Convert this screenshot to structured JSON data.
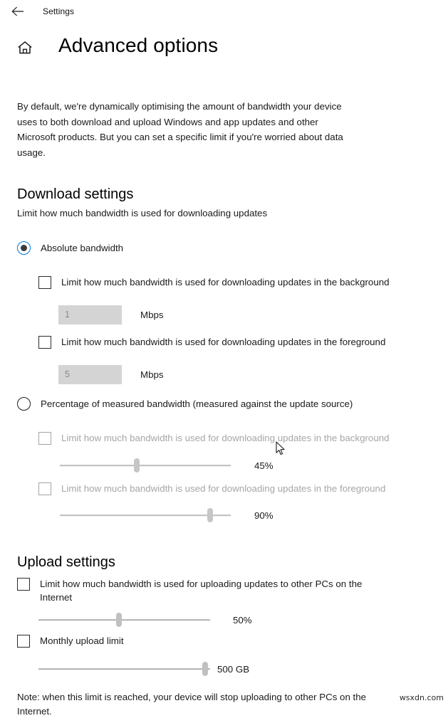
{
  "titlebar": {
    "back_icon": "back-arrow-icon",
    "label": "Settings"
  },
  "header": {
    "home_icon": "home-icon",
    "title": "Advanced options"
  },
  "intro": "By default, we're dynamically optimising the amount of bandwidth your device uses to both download and upload Windows and app updates and other Microsoft products. But you can set a specific limit if you're worried about data usage.",
  "download": {
    "heading": "Download settings",
    "subtitle": "Limit how much bandwidth is used for downloading updates",
    "absolute": {
      "radio_label": "Absolute bandwidth",
      "selected": true,
      "background": {
        "checkbox_label": "Limit how much bandwidth is used for downloading updates in the background",
        "checked": false,
        "value": "1",
        "unit": "Mbps"
      },
      "foreground": {
        "checkbox_label": "Limit how much bandwidth is used for downloading updates in the foreground",
        "checked": false,
        "value": "5",
        "unit": "Mbps"
      }
    },
    "percentage": {
      "radio_label": "Percentage of measured bandwidth (measured against the update source)",
      "selected": false,
      "background": {
        "checkbox_label": "Limit how much bandwidth is used for downloading updates in the background",
        "checked": false,
        "disabled": true,
        "slider_value": "45%",
        "slider_percent": 45
      },
      "foreground": {
        "checkbox_label": "Limit how much bandwidth is used for downloading updates in the foreground",
        "checked": false,
        "disabled": true,
        "slider_value": "90%",
        "slider_percent": 90
      }
    }
  },
  "upload": {
    "heading": "Upload settings",
    "bandwidth": {
      "checkbox_label": "Limit how much bandwidth is used for uploading updates to other PCs on the Internet",
      "checked": false,
      "slider_value": "50%",
      "slider_percent": 50
    },
    "monthly": {
      "checkbox_label": "Monthly upload limit",
      "checked": false,
      "slider_value": "500 GB",
      "slider_percent": 95
    },
    "note": "Note: when this limit is reached, your device will stop uploading to other PCs on the Internet."
  },
  "watermark": "wsxdn.com",
  "colors": {
    "accent": "#0078d7",
    "text": "#1a1a1a",
    "disabled_text": "#a6a6a6",
    "field_bg": "#d4d4d4",
    "track": "#bdbdbd"
  }
}
